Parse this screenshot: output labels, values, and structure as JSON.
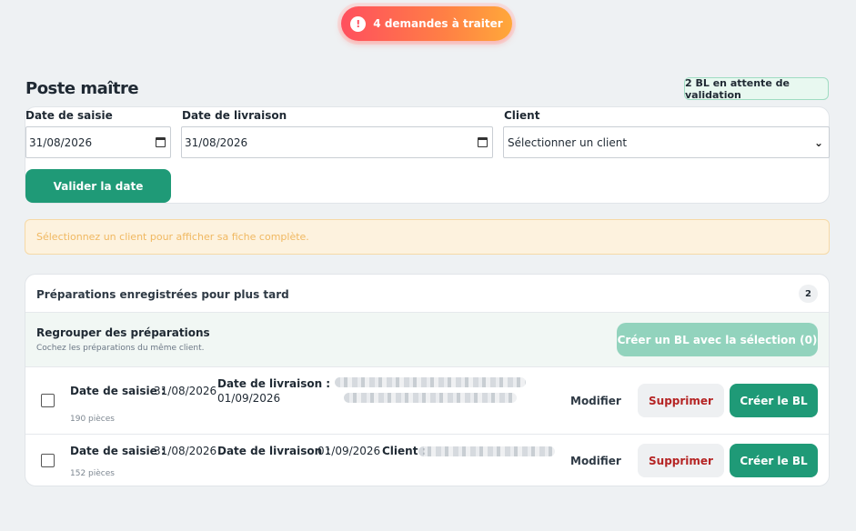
{
  "alert": {
    "text": "4 demandes à traiter",
    "icon": "exclamation-icon"
  },
  "page_title": "Poste maître",
  "bl_badge": "2 BL en attente de validation",
  "form": {
    "date_saisie_label": "Date de saisie",
    "date_saisie_value": "31/08/2026",
    "date_livraison_label": "Date de livraison",
    "date_livraison_value": "31/08/2026",
    "client_label": "Client",
    "client_value": "Sélectionner un client",
    "validate_button": "Valider la date"
  },
  "info_message": "Sélectionnez un client pour afficher sa fiche complète.",
  "preparations": {
    "title": "Préparations enregistrées pour plus tard",
    "count": "2",
    "group_title": "Regrouper des préparations",
    "group_subtitle": "Cochez les préparations du même client.",
    "group_button": "Créer un BL avec la sélection (0)",
    "rows": [
      {
        "saisie_label": "Date de saisie :",
        "saisie_value": "31/08/2026",
        "livraison_label": "Date de livraison :",
        "livraison_value": "01/09/2026",
        "client_label": "",
        "pieces": "190 pièces",
        "modify": "Modifier",
        "delete": "Supprimer",
        "create": "Créer le BL"
      },
      {
        "saisie_label": "Date de saisie :",
        "saisie_value": "31/08/2026",
        "livraison_label": "Date de livraison :",
        "livraison_value": "01/09/2026",
        "client_label": "Client :",
        "pieces": "152 pièces",
        "modify": "Modifier",
        "delete": "Supprimer",
        "create": "Créer le BL"
      }
    ]
  },
  "colors": {
    "primary_green": "#1f9a77",
    "alert_gradient_start": "#ff4f5e",
    "alert_gradient_end": "#ffa83a",
    "danger_text": "#b52424",
    "info_text": "#f0b861"
  }
}
